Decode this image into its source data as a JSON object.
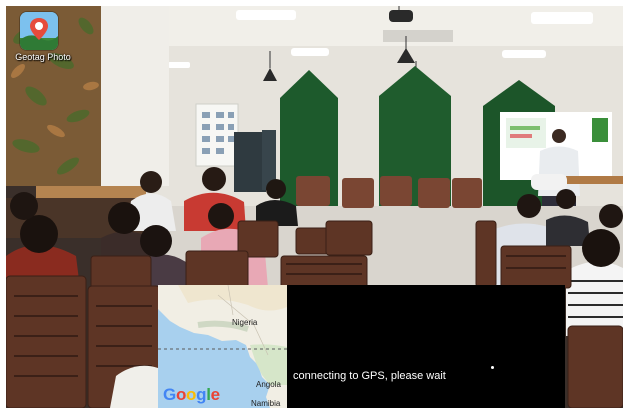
{
  "app": {
    "name": "Geotag Photo"
  },
  "overlay": {
    "status_text": "connecting to GPS, please wait",
    "map_labels": {
      "nigeria": "Nigeria",
      "angola": "Angola",
      "namibia": "Namibia"
    },
    "map_brand": "Google",
    "map_brand_colors": [
      "#4285F4",
      "#EA4335",
      "#FBBC05",
      "#4285F4",
      "#34A853",
      "#EA4335"
    ]
  },
  "scene": {
    "description_colors": {
      "wall": "#e9e7e2",
      "ceiling": "#f3f1ec",
      "green_booths": "#1f5a2c",
      "leaf_wall": "#7a5a34",
      "chairs": "#6b3d2c"
    }
  }
}
